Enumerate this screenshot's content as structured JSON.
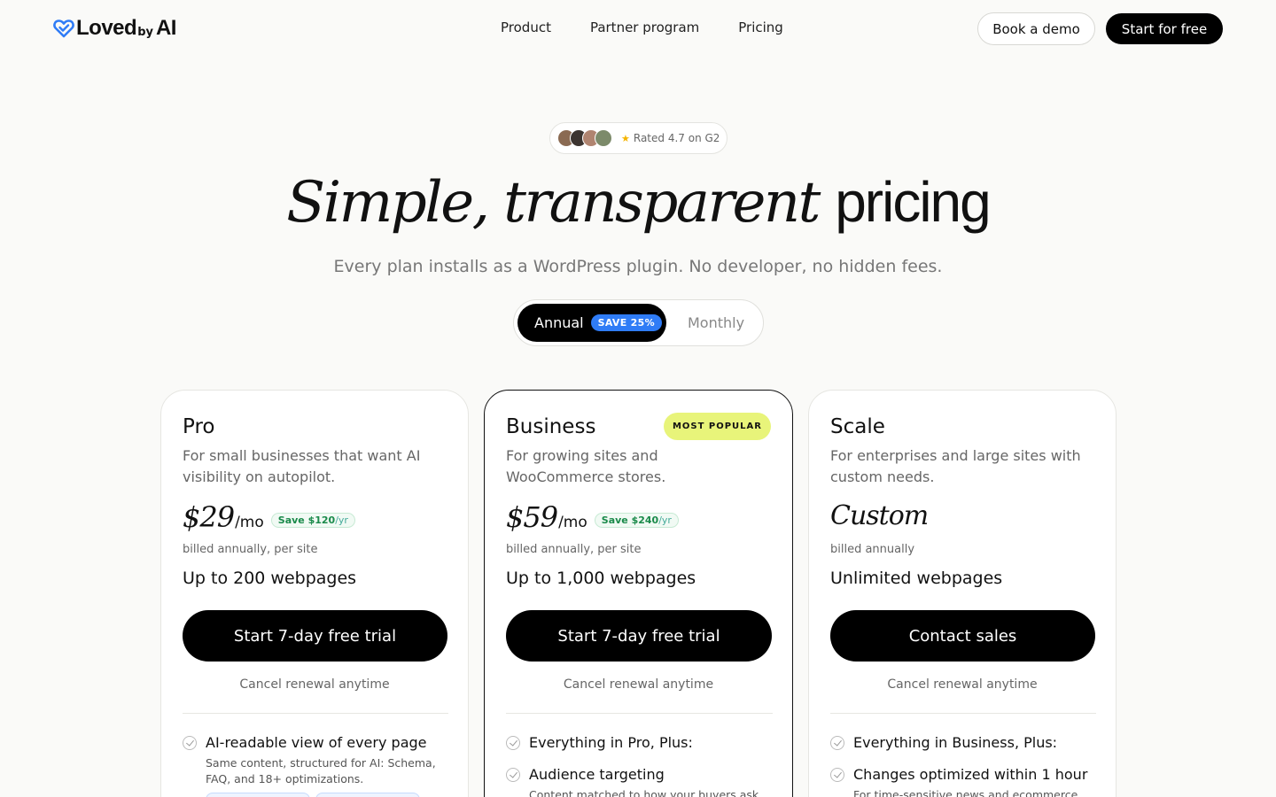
{
  "brand": {
    "name_left": "Loved",
    "name_by": "by",
    "name_right": "AI",
    "accent": "#2f7cf6"
  },
  "nav": {
    "links": [
      "Product",
      "Partner program",
      "Pricing"
    ],
    "demo_label": "Book a demo",
    "start_label": "Start for free"
  },
  "hero": {
    "rating_text": "Rated 4.7 on G2",
    "headline_italic": "Simple, transparent",
    "headline_plain": "pricing",
    "subhead": "Every plan installs as a WordPress plugin. No developer, no hidden fees."
  },
  "toggle": {
    "annual": "Annual",
    "save": "SAVE 25%",
    "monthly": "Monthly",
    "selected": "Annual"
  },
  "plans": [
    {
      "name": "Pro",
      "desc": "For small businesses that want AI visibility on autopilot.",
      "price": "$29",
      "per": "/mo",
      "save": "Save $120",
      "save_per": "/yr",
      "billing": "billed annually, per site",
      "pages": "Up to 200 webpages",
      "cta": "Start 7-day free trial",
      "cancel": "Cancel renewal anytime",
      "features": [
        {
          "title": "AI-readable view of every page",
          "sub": "Same content, structured for AI: Schema, FAQ, and 18+ optimizations."
        }
      ]
    },
    {
      "name": "Business",
      "badge": "MOST POPULAR",
      "desc": "For growing sites and WooCommerce stores.",
      "price": "$59",
      "per": "/mo",
      "save": "Save $240",
      "save_per": "/yr",
      "billing": "billed annually, per site",
      "pages": "Up to 1,000 webpages",
      "cta": "Start 7-day free trial",
      "cancel": "Cancel renewal anytime",
      "features": [
        {
          "title": "Everything in Pro, Plus:"
        },
        {
          "title": "Audience targeting",
          "sub": "Content matched to how your buyers ask AI"
        }
      ]
    },
    {
      "name": "Scale",
      "desc": "For enterprises and large sites with custom needs.",
      "price": "Custom",
      "billing": "billed annually",
      "pages": "Unlimited webpages",
      "cta": "Contact sales",
      "cancel": "Cancel renewal anytime",
      "features": [
        {
          "title": "Everything in Business, Plus:"
        },
        {
          "title": "Changes optimized within 1 hour",
          "sub": "For time-sensitive news and ecommerce"
        }
      ]
    }
  ]
}
